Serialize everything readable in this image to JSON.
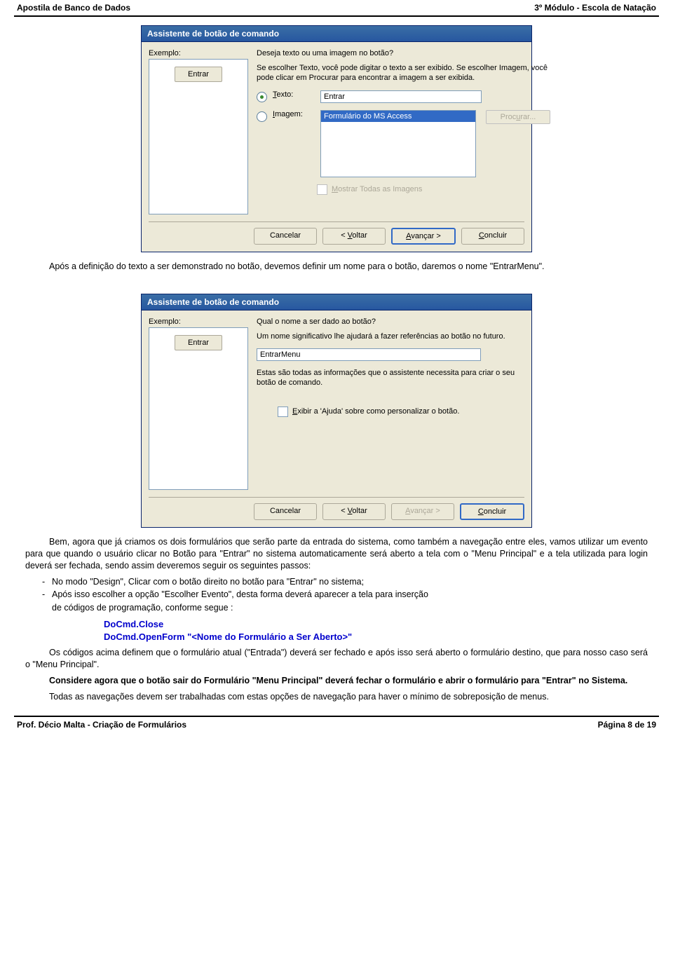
{
  "header": {
    "left": "Apostila de Banco de Dados",
    "right": "3º Módulo - Escola de Natação"
  },
  "footer": {
    "left": "Prof. Décio Malta - Criação de Formulários",
    "right": "Página 8 de 19"
  },
  "dialog1": {
    "title": "Assistente de botão de comando",
    "preview_label": "Exemplo:",
    "sample_button": "Entrar",
    "question": "Deseja texto ou uma imagem no botão?",
    "help": "Se escolher Texto, você pode digitar o texto a ser exibido. Se escolher Imagem, você pode clicar em Procurar para encontrar a imagem a ser exibida.",
    "opt_text_label": "Texto:",
    "opt_text_underline": "T",
    "opt_text_value": "Entrar",
    "opt_image_label": "Imagem:",
    "opt_image_underline": "I",
    "image_selected": "Formulário do MS Access",
    "browse": "Procurar...",
    "browse_underline_index": 4,
    "show_all_label": "Mostrar Todas as Imagens",
    "btn_cancel": "Cancelar",
    "btn_back": "< Voltar",
    "btn_back_u": "V",
    "btn_next": "Avançar >",
    "btn_next_u": "A",
    "btn_finish": "Concluir",
    "btn_finish_u": "C"
  },
  "para1": "Após a definição do texto a ser demonstrado no botão, devemos definir um nome para o botão, daremos o nome \"EntrarMenu\".",
  "dialog2": {
    "title": "Assistente de botão de comando",
    "preview_label": "Exemplo:",
    "sample_button": "Entrar",
    "question": "Qual o nome a ser dado ao botão?",
    "help": "Um nome significativo lhe ajudará a fazer referências ao botão no futuro.",
    "name_value": "EntrarMenu",
    "after": "Estas são todas as informações que o assistente necessita para criar o seu botão de comando.",
    "help_chk_label": "Exibir a 'Ajuda' sobre como personalizar o botão.",
    "btn_cancel": "Cancelar",
    "btn_back": "< Voltar",
    "btn_back_u": "V",
    "btn_next": "Avançar >",
    "btn_next_u": "A",
    "btn_finish": "Concluir",
    "btn_finish_u": "C"
  },
  "para2": "Bem, agora que já criamos os dois formulários que serão parte da entrada do sistema, como também a navegação entre eles, vamos utilizar um evento para que quando o usuário clicar no Botão para \"Entrar\" no sistema automaticamente será aberto a tela com o \"Menu Principal\" e a tela utilizada para login deverá ser fechada, sendo assim deveremos seguir os seguintes passos:",
  "list": {
    "a": "No modo \"Design\", Clicar com o botão direito no botão para \"Entrar\" no sistema;",
    "b_line1": "Após isso escolher a opção \"Escolher Evento\", desta forma deverá aparecer a tela para inserção",
    "b_line2": "de códigos de programação, conforme segue :"
  },
  "code": {
    "line1": "DoCmd.Close",
    "line2": "DoCmd.OpenForm \"<Nome do Formulário a Ser Aberto>\""
  },
  "para3": "Os códigos acima definem que o formulário atual (\"Entrada\") deverá ser fechado e após isso será aberto o formulário destino, que para nosso caso será o \"Menu Principal\".",
  "para4": "Considere agora que o botão sair do Formulário \"Menu Principal\" deverá fechar o formulário e abrir o formulário para \"Entrar\"  no Sistema.",
  "para5": "Todas as navegações devem ser trabalhadas com estas opções de navegação para haver o mínimo de sobreposição de menus."
}
